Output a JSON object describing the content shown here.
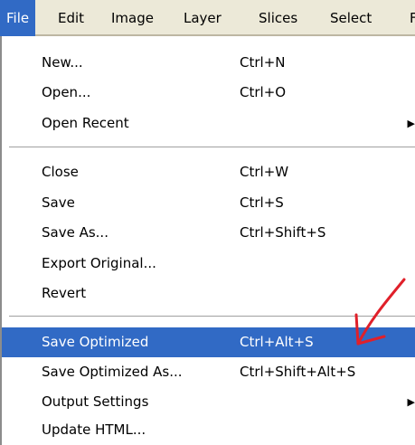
{
  "menubar": {
    "items": [
      {
        "label": "File",
        "active": true
      },
      {
        "label": "Edit"
      },
      {
        "label": "Image"
      },
      {
        "label": "Layer"
      },
      {
        "label": "Slices"
      },
      {
        "label": "Select"
      },
      {
        "label": "F"
      }
    ]
  },
  "file_menu": {
    "groups": [
      [
        {
          "label": "New...",
          "shortcut": "Ctrl+N"
        },
        {
          "label": "Open...",
          "shortcut": "Ctrl+O"
        },
        {
          "label": "Open Recent",
          "shortcut": "",
          "submenu": true
        }
      ],
      [
        {
          "label": "Close",
          "shortcut": "Ctrl+W"
        },
        {
          "label": "Save",
          "shortcut": "Ctrl+S"
        },
        {
          "label": "Save As...",
          "shortcut": "Ctrl+Shift+S"
        },
        {
          "label": "Export Original...",
          "shortcut": ""
        },
        {
          "label": "Revert",
          "shortcut": ""
        }
      ],
      [
        {
          "label": "Save Optimized",
          "shortcut": "Ctrl+Alt+S",
          "highlighted": true
        },
        {
          "label": "Save Optimized As...",
          "shortcut": "Ctrl+Shift+Alt+S"
        },
        {
          "label": "Output Settings",
          "shortcut": "",
          "submenu": true
        },
        {
          "label": "Update HTML...",
          "shortcut": ""
        }
      ]
    ],
    "submenu_arrow": "▶"
  },
  "colors": {
    "highlight": "#316ac5",
    "annotation": "#e0202a"
  }
}
